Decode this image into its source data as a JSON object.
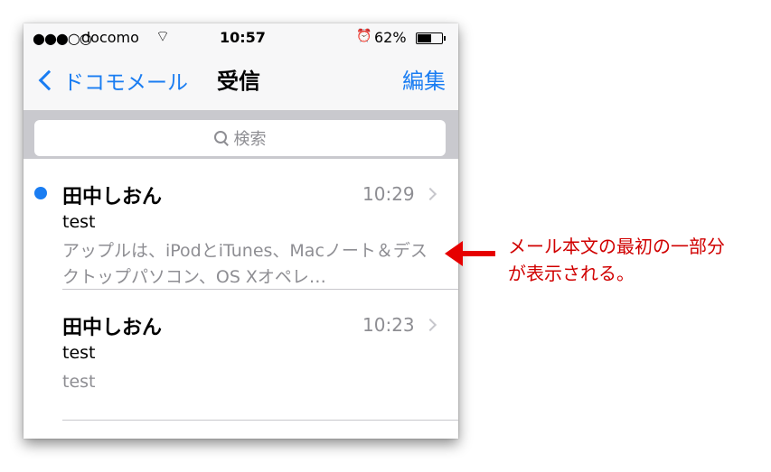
{
  "status_bar": {
    "signal": "●●●○○",
    "carrier": "docomo",
    "wifi_icon": "wifi-icon",
    "time": "10:57",
    "alarm_icon": "alarm-clock-icon",
    "battery_percent": "62%",
    "battery_level": 0.62
  },
  "nav": {
    "back_label": "ドコモメール",
    "title": "受信",
    "edit_label": "編集"
  },
  "search": {
    "placeholder": "検索"
  },
  "messages": [
    {
      "unread": true,
      "sender": "田中しおん",
      "time": "10:29",
      "subject": "test",
      "preview": "アップルは、iPodとiTunes、Macノート＆デスクトップパソコン、OS Xオペレ…"
    },
    {
      "unread": false,
      "sender": "田中しおん",
      "time": "10:23",
      "subject": "test",
      "preview": "test"
    }
  ],
  "annotation": {
    "line1": "メール本文の最初の一部分",
    "line2": "が表示される。"
  },
  "colors": {
    "accent": "#1a7df2",
    "annotation": "#d00000"
  }
}
